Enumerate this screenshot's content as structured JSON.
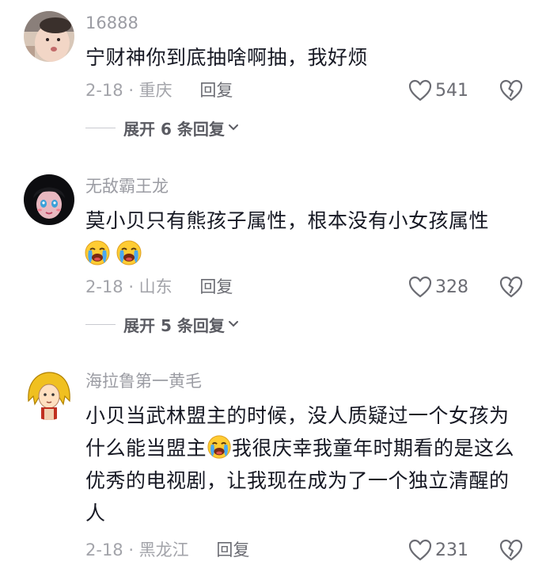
{
  "comments": [
    {
      "username": "16888",
      "text": "宁财神你到底抽啥啊抽，我好烦",
      "date_location": "2-18 · 重庆",
      "reply_label": "回复",
      "likes": "541",
      "expand_label": "展开 6 条回复",
      "avatar_icon": "child-photo-avatar"
    },
    {
      "username": "无敌霸王龙",
      "text": "莫小贝只有熊孩子属性，根本没有小女孩属性",
      "emojis": [
        "crying-emoji",
        "crying-emoji"
      ],
      "date_location": "2-18 · 山东",
      "reply_label": "回复",
      "likes": "328",
      "expand_label": "展开 5 条回复",
      "avatar_icon": "anime-girl-avatar"
    },
    {
      "username": "海拉鲁第一黄毛",
      "text_part1": "小贝当武林盟主的时候，没人质疑过一个女孩为什么能当盟主",
      "text_part2": "我很庆幸我童年时期看的是这么优秀的电视剧，让我现在成为了一个独立清醒的人",
      "inline_emoji": "crying-emoji",
      "date_location": "2-18 · 黑龙江",
      "reply_label": "回复",
      "likes": "231",
      "avatar_icon": "cartoon-blonde-avatar"
    }
  ],
  "colors": {
    "text": "#161823",
    "secondary": "#9b9ca3",
    "background": "#ffffff"
  }
}
